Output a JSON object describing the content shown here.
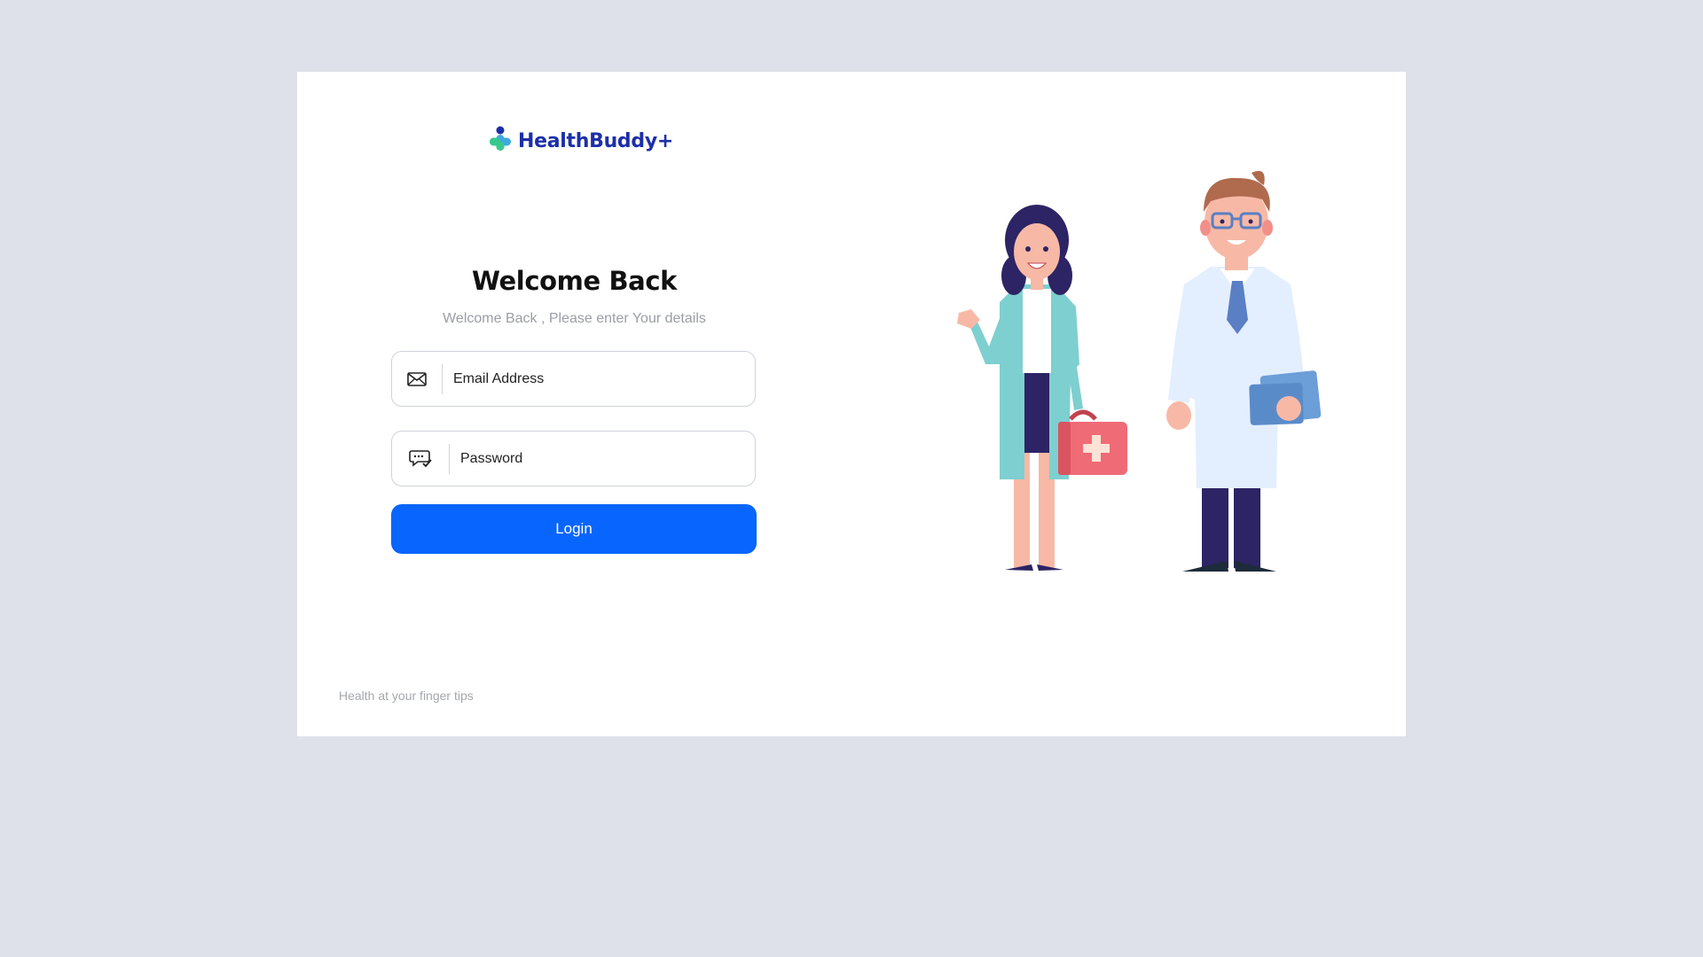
{
  "brand": {
    "name": "HealthBuddy+",
    "color": "#1d2fa8",
    "logo_icon": "medical-cross-icon"
  },
  "login": {
    "title": "Welcome Back",
    "subtitle": "Welcome Back , Please enter Your details",
    "email": {
      "placeholder": "Email Address",
      "value": "",
      "icon": "envelope-icon"
    },
    "password": {
      "placeholder": "Password",
      "value": "",
      "icon": "password-chat-icon"
    },
    "submit_label": "Login",
    "button_color": "#0865fd"
  },
  "footer": {
    "tagline": "Health at your finger tips"
  },
  "illustration": {
    "subject": "doctors-illustration"
  }
}
